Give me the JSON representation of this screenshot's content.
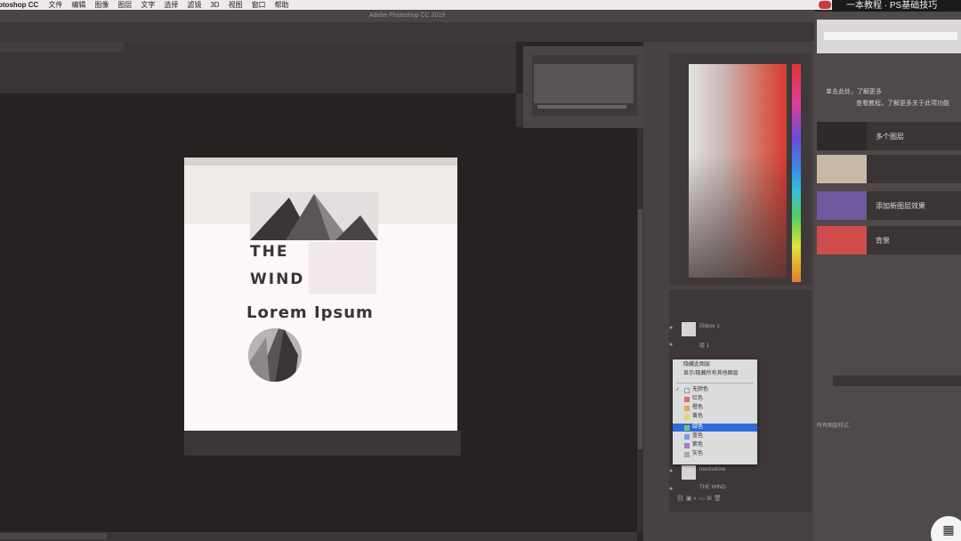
{
  "menubar": {
    "app_name": "otoshop CC",
    "items": [
      "文件",
      "编辑",
      "图像",
      "图层",
      "文字",
      "选择",
      "滤镜",
      "3D",
      "视图",
      "窗口",
      "帮助"
    ]
  },
  "watermark": "一本教程 · PS基础技巧",
  "window": {
    "title": "Adobe Photoshop CC 2019"
  },
  "document": {
    "text_1": "THE",
    "text_2": "WIND",
    "text_3": "Lorem Ipsum"
  },
  "context_menu": {
    "items": [
      {
        "label": "隐藏此图层"
      },
      {
        "label": "显示/隐藏所有其他图层"
      }
    ],
    "colors": [
      {
        "label": "无颜色",
        "swatch": "#dcdcdc",
        "checked": true
      },
      {
        "label": "红色",
        "swatch": "#e36a6a"
      },
      {
        "label": "橙色",
        "swatch": "#e9a35a"
      },
      {
        "label": "黄色",
        "swatch": "#e7d65a"
      },
      {
        "label": "绿色",
        "swatch": "#78c46a",
        "selected": true
      },
      {
        "label": "蓝色",
        "swatch": "#6aa2e6"
      },
      {
        "label": "紫色",
        "swatch": "#a67ad8"
      },
      {
        "label": "灰色",
        "swatch": "#a8a8a8"
      }
    ]
  },
  "layers": {
    "rows": [
      "Ellipse 1",
      "组 1",
      "moonshine",
      "THE WIND"
    ]
  },
  "right_panel": {
    "caption_1": "单击此处，了解更多",
    "caption_2": "查看教程，了解更多关于此项功能",
    "presets": [
      {
        "label": "多个图层",
        "color": "#2e2a2a"
      },
      {
        "label": "",
        "color": "#c9b7a8"
      },
      {
        "label": "添加新图层效果",
        "color": "#6f5aa0"
      },
      {
        "label": "背景",
        "color": "#d04b4b"
      }
    ],
    "caption_3": "所有图层样式"
  },
  "colors": {
    "menubar_bg": "#ecebea",
    "workspace_bg": "#272121",
    "selection_blue": "#2f6bd8"
  }
}
